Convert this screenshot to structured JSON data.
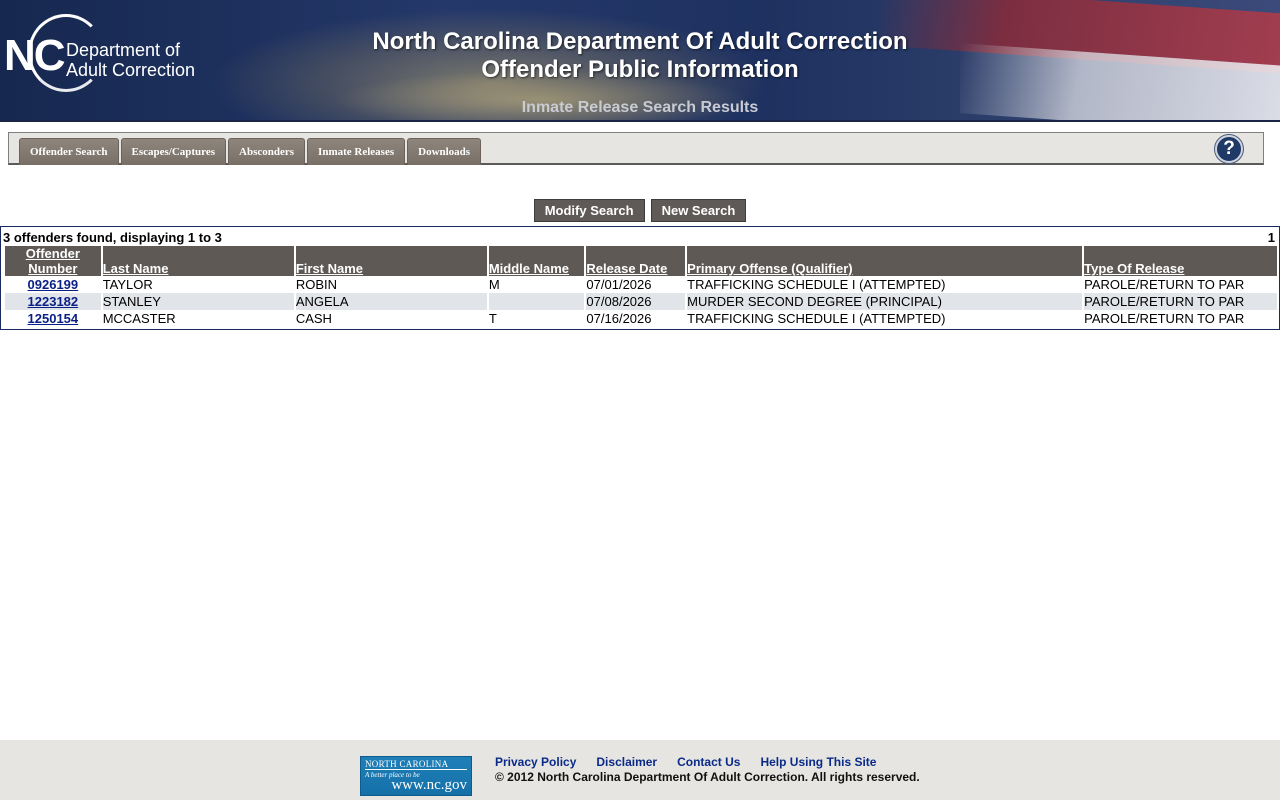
{
  "header": {
    "logo_mark": "NC",
    "logo_line1": "Department of",
    "logo_line2": "Adult Correction",
    "title_line1": "North Carolina Department Of Adult Correction",
    "title_line2": "Offender Public Information",
    "subtitle": "Inmate Release Search Results"
  },
  "nav": {
    "tabs": [
      {
        "label": "Offender Search"
      },
      {
        "label": "Escapes/Captures"
      },
      {
        "label": "Absconders"
      },
      {
        "label": "Inmate Releases"
      },
      {
        "label": "Downloads"
      }
    ],
    "help_symbol": "?",
    "help_icon": "question-circle-icon"
  },
  "actions": {
    "modify_label": "Modify Search",
    "new_label": "New Search"
  },
  "results": {
    "summary": "3 offenders found, displaying 1 to 3",
    "page": "1",
    "columns": {
      "offender_number_1": "Offender",
      "offender_number_2": "Number",
      "last_name": "Last Name",
      "first_name": "First Name",
      "middle_name": "Middle Name",
      "release_date": "Release Date",
      "primary_offense": "Primary Offense (Qualifier)",
      "release_type": "Type Of Release"
    },
    "rows": [
      {
        "number": "0926199",
        "last": "TAYLOR",
        "first": "ROBIN",
        "middle": "M",
        "date": "07/01/2026",
        "offense": "TRAFFICKING SCHEDULE I (ATTEMPTED)",
        "type": "PAROLE/RETURN TO PAR"
      },
      {
        "number": "1223182",
        "last": "STANLEY",
        "first": "ANGELA",
        "middle": "",
        "date": "07/08/2026",
        "offense": "MURDER SECOND DEGREE (PRINCIPAL)",
        "type": "PAROLE/RETURN TO PAR"
      },
      {
        "number": "1250154",
        "last": "MCCASTER",
        "first": "CASH",
        "middle": "T",
        "date": "07/16/2026",
        "offense": "TRAFFICKING SCHEDULE I (ATTEMPTED)",
        "type": "PAROLE/RETURN TO PAR"
      }
    ]
  },
  "footer": {
    "ncgov_line1": "NORTH CAROLINA",
    "ncgov_line2": "A better place to be",
    "ncgov_line3": "www.nc.gov",
    "links": [
      {
        "label": "Privacy Policy"
      },
      {
        "label": "Disclaimer"
      },
      {
        "label": "Contact Us"
      },
      {
        "label": "Help Using This Site"
      }
    ],
    "copyright": "© 2012 North Carolina Department Of Adult Correction. All rights reserved."
  },
  "colors": {
    "banner_bg": "#24386a",
    "tab_bg": "#8e857c",
    "button_bg": "#5f5a57",
    "header_cell_bg": "#5e5955",
    "alt_row_bg": "#e1e4e8",
    "link_color": "#0a1f86",
    "footer_bg": "#e6e5e1"
  }
}
